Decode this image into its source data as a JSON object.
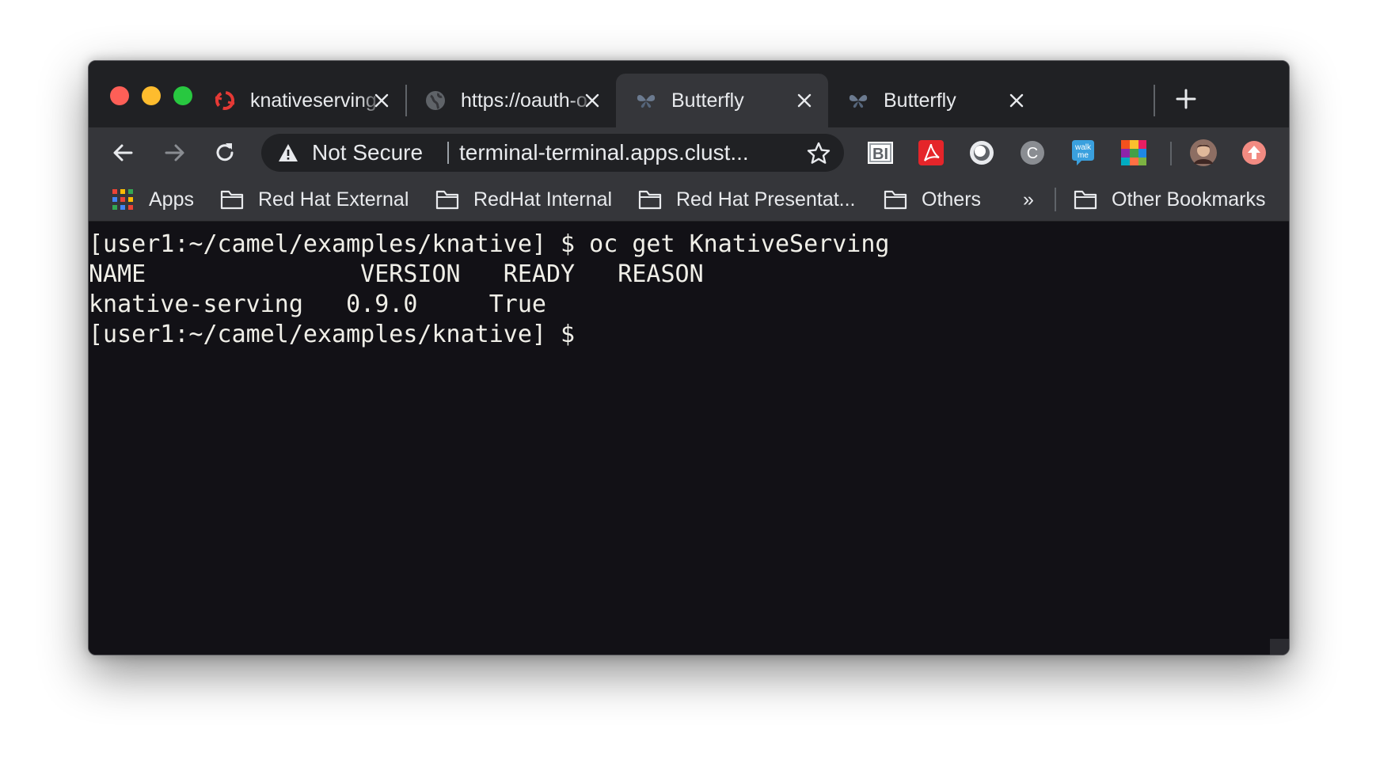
{
  "browser": {
    "tabs": [
      {
        "title": "knativeserving",
        "icon": "openshift-icon",
        "active": false
      },
      {
        "title": "https://oauth-o",
        "icon": "globe-icon",
        "active": false
      },
      {
        "title": "Butterfly",
        "icon": "butterfly-icon",
        "active": true
      },
      {
        "title": "Butterfly",
        "icon": "butterfly-icon",
        "active": false
      }
    ],
    "omnibox": {
      "security_label": "Not Secure",
      "url": "terminal-terminal.apps.clust..."
    },
    "extensions": [
      "bi-extension-icon",
      "acrobat-extension-icon",
      "circle-extension-icon",
      "c-extension-icon",
      "walkme-extension-icon",
      "colorful-grid-extension-icon",
      "profile-avatar",
      "update-icon"
    ],
    "bookmarks": {
      "apps_label": "Apps",
      "items": [
        "Red Hat External",
        "RedHat Internal",
        "Red Hat Presentat...",
        "Others"
      ],
      "overflow_label": "»",
      "other_label": "Other Bookmarks"
    }
  },
  "terminal": {
    "lines": [
      "[user1:~/camel/examples/knative] $ oc get KnativeServing",
      "NAME               VERSION   READY   REASON",
      "knative-serving   0.9.0     True",
      "[user1:~/camel/examples/knative] $ "
    ]
  },
  "colors": {
    "terminal_bg": "#121116",
    "terminal_fg": "#f0efe8",
    "chrome_dark": "#202124",
    "chrome_toolbar": "#35363a"
  }
}
